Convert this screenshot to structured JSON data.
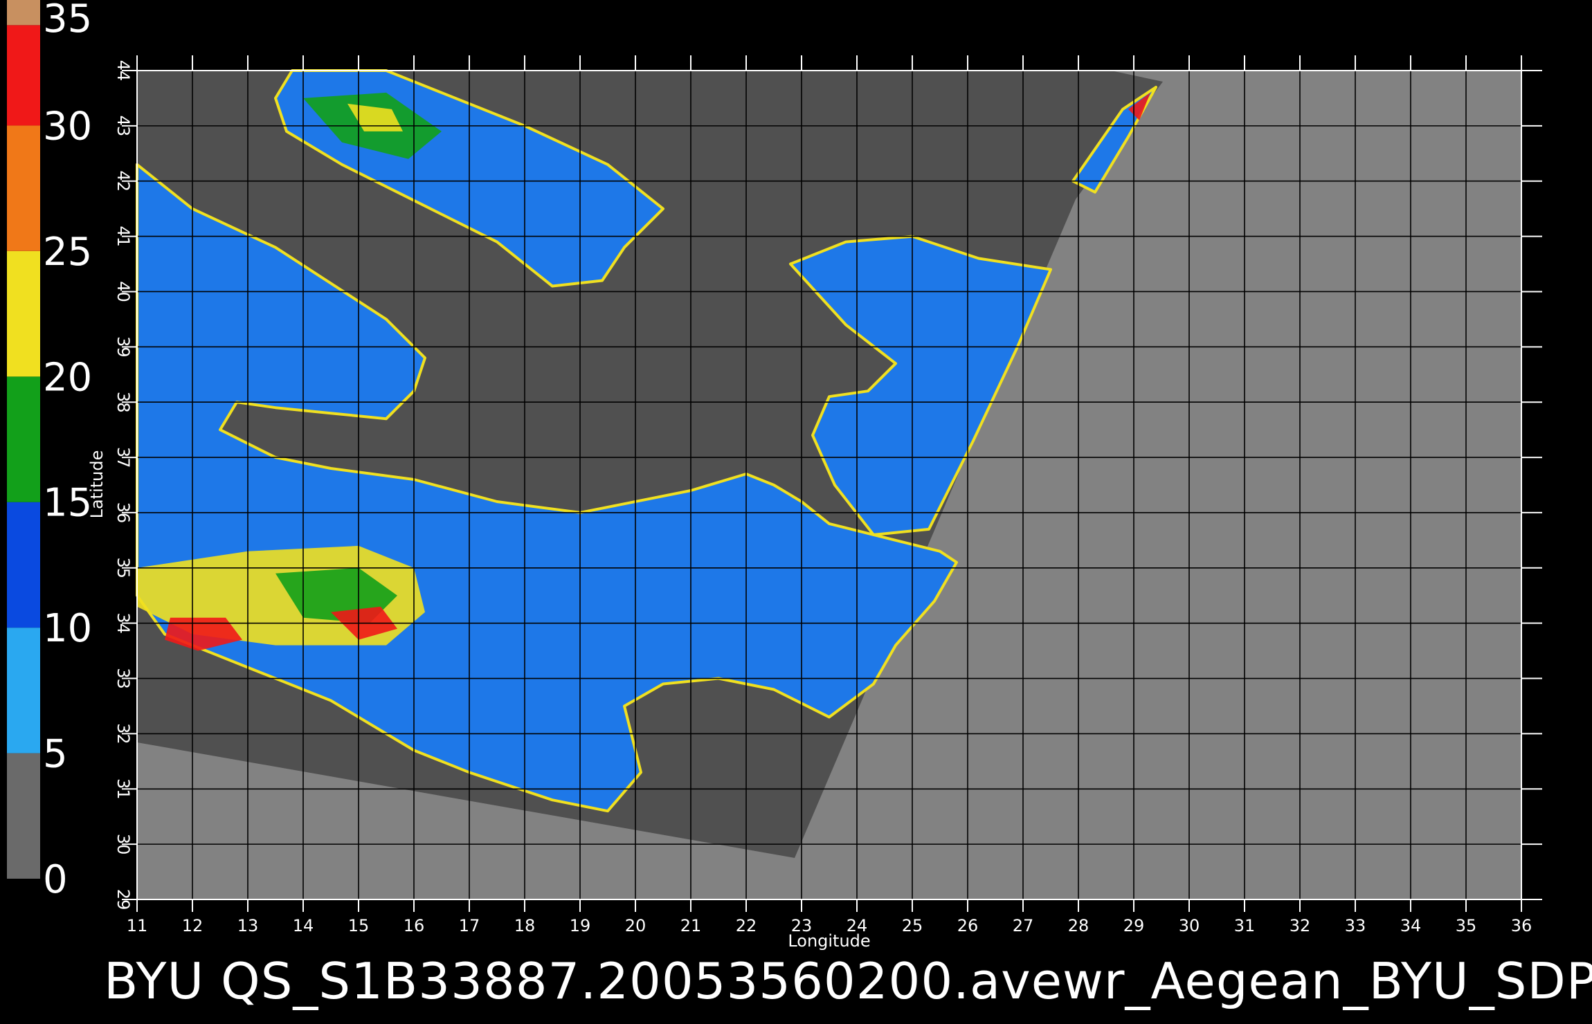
{
  "caption": "BYU  QS_S1B33887.20053560200.avewr_Aegean_BYU_SDP",
  "axes": {
    "xlabel": "Longitude",
    "ylabel": "Latitude",
    "lon_range": [
      11,
      36
    ],
    "lat_range": [
      29,
      44
    ],
    "lon_ticks": [
      11,
      12,
      13,
      14,
      15,
      16,
      17,
      18,
      19,
      20,
      21,
      22,
      23,
      24,
      25,
      26,
      27,
      28,
      29,
      30,
      31,
      32,
      33,
      34,
      35,
      36
    ],
    "lat_ticks": [
      29,
      30,
      31,
      32,
      33,
      34,
      35,
      36,
      37,
      38,
      39,
      40,
      41,
      42,
      43,
      44
    ],
    "grid": true
  },
  "colorbar": {
    "range": [
      0,
      35
    ],
    "labels": [
      "35",
      "30",
      "25",
      "20",
      "15",
      "10",
      "5",
      "0"
    ],
    "bands": [
      {
        "from": 0,
        "to": 5,
        "color": "#6a6a6a"
      },
      {
        "from": 5,
        "to": 10,
        "color": "#2aa8f0"
      },
      {
        "from": 10,
        "to": 15,
        "color": "#0a4ae0"
      },
      {
        "from": 15,
        "to": 20,
        "color": "#12a01a"
      },
      {
        "from": 20,
        "to": 25,
        "color": "#f0e020"
      },
      {
        "from": 25,
        "to": 30,
        "color": "#f07818"
      },
      {
        "from": 30,
        "to": 34,
        "color": "#f01818"
      },
      {
        "from": 34,
        "to": 35,
        "color": "#c89060"
      }
    ]
  },
  "colors": {
    "background": "#000000",
    "no_data": "#828282",
    "land": "#505050",
    "grid": "#000000"
  },
  "wind_field": {
    "regions": [
      {
        "name": "western-ionian",
        "color": "#1e78e8",
        "points": [
          [
            11,
            42.3
          ],
          [
            12,
            41.5
          ],
          [
            13.5,
            40.8
          ],
          [
            15.5,
            39.5
          ],
          [
            16.2,
            38.8
          ],
          [
            16,
            38.2
          ],
          [
            15.5,
            37.7
          ],
          [
            14.5,
            37.8
          ],
          [
            13.5,
            37.9
          ],
          [
            12.8,
            38
          ],
          [
            12.5,
            37.5
          ],
          [
            13.5,
            37
          ],
          [
            14.5,
            36.8
          ],
          [
            16,
            36.6
          ],
          [
            17.5,
            36.2
          ],
          [
            19,
            36
          ],
          [
            21,
            36.4
          ],
          [
            22,
            36.7
          ],
          [
            22.5,
            36.5
          ],
          [
            23,
            36.2
          ],
          [
            23.5,
            35.8
          ],
          [
            24.3,
            35.6
          ],
          [
            25.5,
            35.3
          ],
          [
            25.8,
            35.1
          ],
          [
            25.4,
            34.4
          ],
          [
            24.7,
            33.6
          ],
          [
            24.3,
            32.9
          ],
          [
            23.5,
            32.3
          ],
          [
            22.5,
            32.8
          ],
          [
            21.5,
            33
          ],
          [
            20.5,
            32.9
          ],
          [
            19.8,
            32.5
          ],
          [
            20.1,
            31.3
          ],
          [
            19.5,
            30.6
          ],
          [
            18.5,
            30.8
          ],
          [
            17,
            31.3
          ],
          [
            16,
            31.7
          ],
          [
            14.5,
            32.6
          ],
          [
            13,
            33.2
          ],
          [
            11.5,
            33.8
          ],
          [
            11,
            34.5
          ]
        ]
      },
      {
        "name": "adriatic",
        "color": "#1e78e8",
        "points": [
          [
            15.5,
            44
          ],
          [
            18,
            43
          ],
          [
            19.5,
            42.3
          ],
          [
            20.5,
            41.5
          ],
          [
            19.8,
            40.8
          ],
          [
            19.4,
            40.2
          ],
          [
            18.5,
            40.1
          ],
          [
            17.5,
            40.9
          ],
          [
            16.3,
            41.5
          ],
          [
            14.7,
            42.3
          ],
          [
            13.7,
            42.9
          ],
          [
            13.5,
            43.5
          ],
          [
            13.8,
            44
          ]
        ]
      },
      {
        "name": "aegean",
        "color": "#1e78e8",
        "points": [
          [
            22.8,
            40.5
          ],
          [
            23.8,
            40.9
          ],
          [
            25,
            41
          ],
          [
            26.2,
            40.6
          ],
          [
            27.5,
            40.4
          ],
          [
            26.9,
            39
          ],
          [
            26.1,
            37.3
          ],
          [
            25.3,
            35.7
          ],
          [
            24.3,
            35.6
          ],
          [
            23.6,
            36.5
          ],
          [
            23.2,
            37.4
          ],
          [
            23.5,
            38.1
          ],
          [
            24.2,
            38.2
          ],
          [
            24.7,
            38.7
          ],
          [
            23.8,
            39.4
          ]
        ]
      },
      {
        "name": "black-sea-corner",
        "color": "#1e78e8",
        "points": [
          [
            27.9,
            42
          ],
          [
            28.8,
            43.3
          ],
          [
            29.4,
            43.7
          ],
          [
            28.9,
            42.8
          ],
          [
            28.3,
            41.8
          ]
        ]
      }
    ],
    "hotspots": [
      {
        "name": "west-yellow",
        "color": "#f0e020",
        "points": [
          [
            11,
            35
          ],
          [
            13,
            35.3
          ],
          [
            15,
            35.4
          ],
          [
            16,
            35
          ],
          [
            16.2,
            34.2
          ],
          [
            15.5,
            33.6
          ],
          [
            13.5,
            33.6
          ],
          [
            12,
            33.8
          ],
          [
            11,
            34.3
          ]
        ]
      },
      {
        "name": "west-green",
        "color": "#12a01a",
        "points": [
          [
            13.5,
            34.9
          ],
          [
            15,
            35
          ],
          [
            15.7,
            34.5
          ],
          [
            15.2,
            34
          ],
          [
            14,
            34.1
          ]
        ]
      },
      {
        "name": "west-red-a",
        "color": "#f01818",
        "points": [
          [
            11.6,
            34.1
          ],
          [
            12.6,
            34.1
          ],
          [
            12.9,
            33.7
          ],
          [
            12.1,
            33.5
          ],
          [
            11.5,
            33.7
          ]
        ]
      },
      {
        "name": "west-red-b",
        "color": "#f01818",
        "points": [
          [
            14.5,
            34.2
          ],
          [
            15.4,
            34.3
          ],
          [
            15.7,
            33.9
          ],
          [
            15,
            33.7
          ]
        ]
      },
      {
        "name": "adriatic-green",
        "color": "#12a01a",
        "points": [
          [
            14,
            43.5
          ],
          [
            15.5,
            43.6
          ],
          [
            16.5,
            42.9
          ],
          [
            15.9,
            42.4
          ],
          [
            14.7,
            42.7
          ]
        ]
      },
      {
        "name": "adriatic-yellow",
        "color": "#f0e020",
        "points": [
          [
            14.8,
            43.4
          ],
          [
            15.6,
            43.3
          ],
          [
            15.8,
            42.9
          ],
          [
            15.1,
            42.9
          ]
        ]
      },
      {
        "name": "black-sea-red",
        "color": "#f01818",
        "points": [
          [
            28.9,
            43.3
          ],
          [
            29.3,
            43.6
          ],
          [
            29.1,
            43.1
          ]
        ]
      }
    ]
  }
}
